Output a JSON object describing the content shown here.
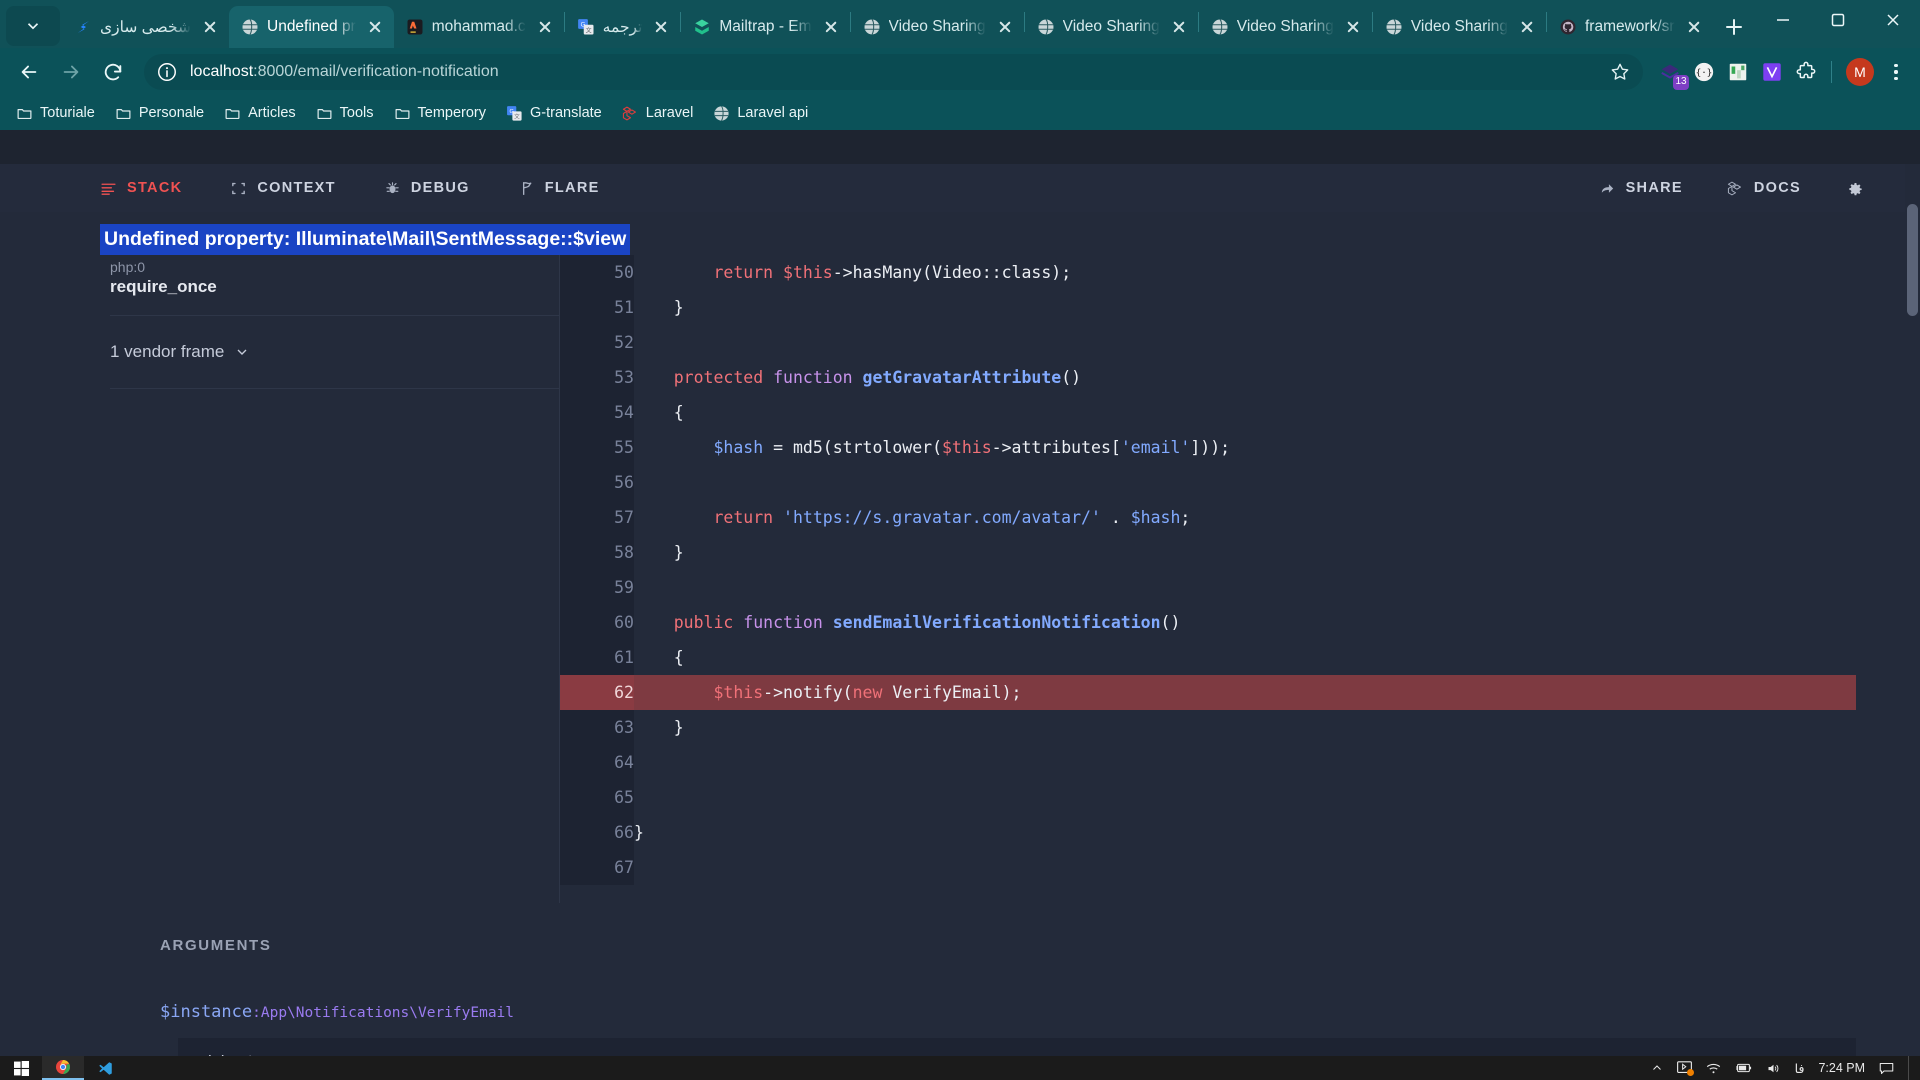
{
  "browser": {
    "tabs": [
      {
        "title": "شخصی سازی",
        "favicon": "jira-icon",
        "active": false,
        "rtl": true
      },
      {
        "title": "Undefined pr",
        "favicon": "globe-icon",
        "active": true,
        "rtl": false
      },
      {
        "title": "mohammad.c",
        "favicon": "phpstorm-icon",
        "active": false,
        "rtl": false
      },
      {
        "title": "ترجمه",
        "favicon": "gtranslate-icon",
        "active": false,
        "rtl": true
      },
      {
        "title": "Mailtrap - Em",
        "favicon": "mailtrap-icon",
        "active": false,
        "rtl": false
      },
      {
        "title": "Video Sharing",
        "favicon": "globe-icon",
        "active": false,
        "rtl": false
      },
      {
        "title": "Video Sharing",
        "favicon": "globe-icon",
        "active": false,
        "rtl": false
      },
      {
        "title": "Video Sharing",
        "favicon": "globe-icon",
        "active": false,
        "rtl": false
      },
      {
        "title": "Video Sharing",
        "favicon": "globe-icon",
        "active": false,
        "rtl": false
      },
      {
        "title": "framework/sr",
        "favicon": "github-icon",
        "active": false,
        "rtl": false
      }
    ],
    "address": {
      "host": "localhost",
      "rest": ":8000/email/verification-notification"
    },
    "extension_badge": "13",
    "profile_initial": "M",
    "bookmarks": [
      {
        "label": "Toturiale",
        "icon": "folder-icon"
      },
      {
        "label": "Personale",
        "icon": "folder-icon"
      },
      {
        "label": "Articles",
        "icon": "folder-icon"
      },
      {
        "label": "Tools",
        "icon": "folder-icon"
      },
      {
        "label": "Temperory",
        "icon": "folder-icon"
      },
      {
        "label": "G-translate",
        "icon": "gtranslate-icon"
      },
      {
        "label": "Laravel",
        "icon": "laravel-icon"
      },
      {
        "label": "Laravel api",
        "icon": "globe-icon"
      }
    ]
  },
  "ignition": {
    "nav_left": [
      {
        "label": "STACK",
        "icon": "stack-icon",
        "active": true
      },
      {
        "label": "CONTEXT",
        "icon": "context-icon",
        "active": false
      },
      {
        "label": "DEBUG",
        "icon": "bug-icon",
        "active": false
      },
      {
        "label": "FLARE",
        "icon": "flare-icon",
        "active": false
      }
    ],
    "nav_right": [
      {
        "label": "SHARE",
        "icon": "share-icon"
      },
      {
        "label": "DOCS",
        "icon": "laravel-icon"
      }
    ],
    "settings_icon": "gear-icon",
    "error_title": "Undefined property: Illuminate\\Mail\\SentMessage::$view",
    "frames": [
      {
        "sub": "php:0",
        "fn": "require_once"
      }
    ],
    "vendor_frames_label": "1 vendor frame",
    "code": [
      {
        "num": "50",
        "highlight": false,
        "tokens": [
          {
            "t": "        ",
            "c": "k-plain"
          },
          {
            "t": "return",
            "c": "k-red"
          },
          {
            "t": " ",
            "c": "k-plain"
          },
          {
            "t": "$this",
            "c": "k-red"
          },
          {
            "t": "->",
            "c": "k-white"
          },
          {
            "t": "hasMany",
            "c": "k-white"
          },
          {
            "t": "(",
            "c": "k-white"
          },
          {
            "t": "Video",
            "c": "k-white"
          },
          {
            "t": "::",
            "c": "k-white"
          },
          {
            "t": "class",
            "c": "k-white"
          },
          {
            "t": ");",
            "c": "k-white"
          }
        ]
      },
      {
        "num": "51",
        "highlight": false,
        "tokens": [
          {
            "t": "    }",
            "c": "k-white"
          }
        ]
      },
      {
        "num": "52",
        "highlight": false,
        "tokens": [
          {
            "t": "",
            "c": "k-plain"
          }
        ]
      },
      {
        "num": "53",
        "highlight": false,
        "tokens": [
          {
            "t": "    ",
            "c": "k-plain"
          },
          {
            "t": "protected",
            "c": "k-red"
          },
          {
            "t": " ",
            "c": "k-plain"
          },
          {
            "t": "function",
            "c": "k-purple"
          },
          {
            "t": " ",
            "c": "k-plain"
          },
          {
            "t": "getGravatarAttribute",
            "c": "k-blue bold"
          },
          {
            "t": "()",
            "c": "k-white"
          }
        ]
      },
      {
        "num": "54",
        "highlight": false,
        "tokens": [
          {
            "t": "    {",
            "c": "k-white"
          }
        ]
      },
      {
        "num": "55",
        "highlight": false,
        "tokens": [
          {
            "t": "        ",
            "c": "k-plain"
          },
          {
            "t": "$hash",
            "c": "k-blue"
          },
          {
            "t": " = ",
            "c": "k-white"
          },
          {
            "t": "md5",
            "c": "k-white"
          },
          {
            "t": "(",
            "c": "k-white"
          },
          {
            "t": "strtolower",
            "c": "k-white"
          },
          {
            "t": "(",
            "c": "k-white"
          },
          {
            "t": "$this",
            "c": "k-red"
          },
          {
            "t": "->",
            "c": "k-white"
          },
          {
            "t": "attributes",
            "c": "k-white"
          },
          {
            "t": "[",
            "c": "k-white"
          },
          {
            "t": "'email'",
            "c": "k-blue"
          },
          {
            "t": "]));",
            "c": "k-white"
          }
        ]
      },
      {
        "num": "56",
        "highlight": false,
        "tokens": [
          {
            "t": "",
            "c": "k-plain"
          }
        ]
      },
      {
        "num": "57",
        "highlight": false,
        "tokens": [
          {
            "t": "        ",
            "c": "k-plain"
          },
          {
            "t": "return",
            "c": "k-red"
          },
          {
            "t": " ",
            "c": "k-plain"
          },
          {
            "t": "'https://s.gravatar.com/avatar/'",
            "c": "k-blue"
          },
          {
            "t": " . ",
            "c": "k-white"
          },
          {
            "t": "$hash",
            "c": "k-blue"
          },
          {
            "t": ";",
            "c": "k-white"
          }
        ]
      },
      {
        "num": "58",
        "highlight": false,
        "tokens": [
          {
            "t": "    }",
            "c": "k-white"
          }
        ]
      },
      {
        "num": "59",
        "highlight": false,
        "tokens": [
          {
            "t": "",
            "c": "k-plain"
          }
        ]
      },
      {
        "num": "60",
        "highlight": false,
        "tokens": [
          {
            "t": "    ",
            "c": "k-plain"
          },
          {
            "t": "public",
            "c": "k-red"
          },
          {
            "t": " ",
            "c": "k-plain"
          },
          {
            "t": "function",
            "c": "k-purple"
          },
          {
            "t": " ",
            "c": "k-plain"
          },
          {
            "t": "sendEmailVerificationNotification",
            "c": "k-blue bold"
          },
          {
            "t": "()",
            "c": "k-white"
          }
        ]
      },
      {
        "num": "61",
        "highlight": false,
        "tokens": [
          {
            "t": "    {",
            "c": "k-white"
          }
        ]
      },
      {
        "num": "62",
        "highlight": true,
        "tokens": [
          {
            "t": "        ",
            "c": "k-plain"
          },
          {
            "t": "$this",
            "c": "k-red"
          },
          {
            "t": "->",
            "c": "k-white"
          },
          {
            "t": "notify",
            "c": "k-white"
          },
          {
            "t": "(",
            "c": "k-white"
          },
          {
            "t": "new",
            "c": "k-red"
          },
          {
            "t": " ",
            "c": "k-plain"
          },
          {
            "t": "VerifyEmail",
            "c": "k-white"
          },
          {
            "t": ");",
            "c": "k-white"
          }
        ]
      },
      {
        "num": "63",
        "highlight": false,
        "tokens": [
          {
            "t": "    }",
            "c": "k-white"
          }
        ]
      },
      {
        "num": "64",
        "highlight": false,
        "tokens": [
          {
            "t": "",
            "c": "k-plain"
          }
        ]
      },
      {
        "num": "65",
        "highlight": false,
        "tokens": [
          {
            "t": "",
            "c": "k-plain"
          }
        ]
      },
      {
        "num": "66",
        "highlight": false,
        "tokens": [
          {
            "t": "}",
            "c": "k-white"
          }
        ]
      },
      {
        "num": "67",
        "highlight": false,
        "tokens": [
          {
            "t": "",
            "c": "k-plain"
          }
        ]
      }
    ],
    "arguments": {
      "heading": "ARGUMENTS",
      "name": "$instance",
      "type": ":App\\Notifications\\VerifyEmail",
      "value": "object"
    }
  },
  "taskbar": {
    "start_icon": "windows-icon",
    "apps": [
      {
        "icon": "chrome-icon",
        "active": true
      },
      {
        "icon": "vscode-icon",
        "active": false
      }
    ],
    "tray": [
      {
        "icon": "chevron-up-icon"
      },
      {
        "icon": "screencast-icon"
      },
      {
        "icon": "wifi-icon"
      },
      {
        "icon": "battery-charging-icon"
      },
      {
        "icon": "volume-icon"
      }
    ],
    "language": "فا",
    "clock": "7:24 PM",
    "action_center_icon": "speech-bubble-icon"
  },
  "colors": {
    "chrome_frame": "#105158",
    "chrome_toolbar": "#0b5259",
    "ignition_bg": "#232a3a",
    "accent_red": "#f05252",
    "selection_blue": "#1a44c4",
    "highlight_row": "#7e3a41"
  }
}
